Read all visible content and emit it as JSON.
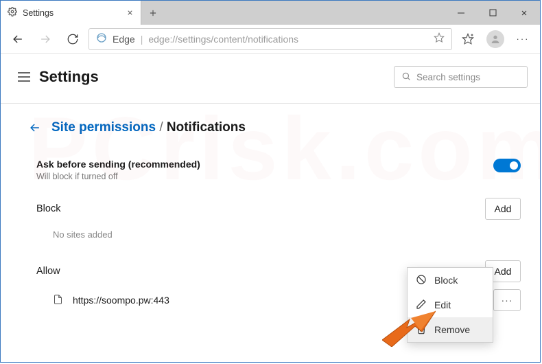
{
  "window": {
    "tab_title": "Settings",
    "new_tab_tooltip": "New tab"
  },
  "addressbar": {
    "identity_label": "Edge",
    "url": "edge://settings/content/notifications"
  },
  "header": {
    "page_title": "Settings",
    "search_placeholder": "Search settings"
  },
  "breadcrumb": {
    "parent": "Site permissions",
    "current": "Notifications"
  },
  "ask": {
    "label": "Ask before sending (recommended)",
    "sub": "Will block if turned off",
    "enabled": true
  },
  "block": {
    "title": "Block",
    "add_label": "Add",
    "empty": "No sites added"
  },
  "allow": {
    "title": "Allow",
    "add_label": "Add",
    "sites": [
      {
        "url": "https://soompo.pw:443"
      }
    ]
  },
  "context_menu": {
    "items": [
      {
        "label": "Block",
        "icon": "block-icon"
      },
      {
        "label": "Edit",
        "icon": "pencil-icon"
      },
      {
        "label": "Remove",
        "icon": "trash-icon"
      }
    ],
    "highlighted_index": 2
  }
}
